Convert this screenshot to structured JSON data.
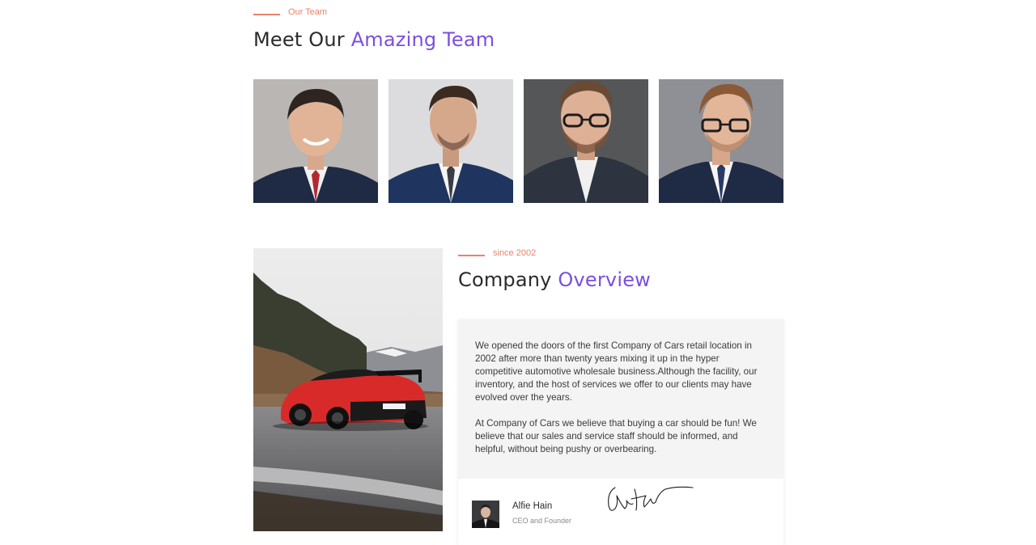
{
  "team_section": {
    "eyebrow": "Our Team",
    "heading_plain": "Meet Our ",
    "heading_accent": "Amazing Team",
    "members": [
      {
        "photo": "team-member-1"
      },
      {
        "photo": "team-member-2"
      },
      {
        "photo": "team-member-3"
      },
      {
        "photo": "team-member-4"
      }
    ]
  },
  "overview_section": {
    "eyebrow": "since 2002",
    "heading_plain": "Company ",
    "heading_accent": "Overview",
    "paragraph_1": "We opened the doors of the first Company of Cars retail location in 2002 after more than twenty years mixing it up in the hyper competitive automotive wholesale business.Although the facility, our inventory, and the host of services we offer to our clients may have evolved over the years.",
    "paragraph_2": "At Company of Cars we believe that buying a car should be fun! We believe that our sales and service staff should be informed, and helpful, without being pushy or overbearing.",
    "founder": {
      "name": "Alfie Hain",
      "role": "CEO and Founder"
    }
  },
  "colors": {
    "accent_purple": "#7a4fe0",
    "eyebrow_coral": "#e8826b",
    "card_bg": "#f4f4f4"
  }
}
